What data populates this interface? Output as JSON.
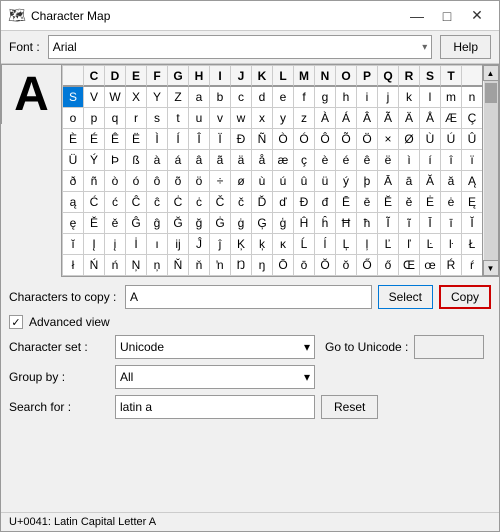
{
  "window": {
    "title": "Character Map",
    "icon": "🗺"
  },
  "titleButtons": {
    "minimize": "—",
    "maximize": "□",
    "close": "✕"
  },
  "toolbar": {
    "fontLabel": "Font :",
    "fontValue": "Arial",
    "helpLabel": "Help"
  },
  "grid": {
    "largeChar": "A",
    "headers": [
      "C",
      "D",
      "E",
      "F",
      "G",
      "H",
      "I",
      "J",
      "K",
      "L",
      "M",
      "N",
      "O",
      "P",
      "Q",
      "R",
      "S",
      "T"
    ],
    "rows": [
      [
        "S",
        "V",
        "W",
        "X",
        "Y",
        "Z",
        "a",
        "b",
        "c",
        "d",
        "e",
        "f",
        "g",
        "h",
        "i",
        "j",
        "k",
        "l",
        "m",
        "n"
      ],
      [
        "o",
        "p",
        "q",
        "r",
        "s",
        "t",
        "u",
        "v",
        "w",
        "x",
        "y",
        "z",
        "À",
        "Á",
        "Â",
        "Ã",
        "Ä",
        "Å",
        "Æ",
        "Ç"
      ],
      [
        "È",
        "É",
        "Ê",
        "Ë",
        "Ì",
        "Í",
        "Î",
        "Ï",
        "Ð",
        "Ñ",
        "Ò",
        "Ó",
        "Ô",
        "Õ",
        "Ö",
        "×",
        "Ø",
        "Ù",
        "Ú",
        "Û"
      ],
      [
        "Ü",
        "Ý",
        "Þ",
        "ß",
        "à",
        "á",
        "â",
        "ã",
        "ä",
        "å",
        "æ",
        "ç",
        "è",
        "é",
        "ê",
        "ë",
        "ì",
        "í",
        "î",
        "ï"
      ],
      [
        "ð",
        "ñ",
        "ò",
        "ó",
        "ô",
        "õ",
        "ö",
        "÷",
        "ø",
        "ù",
        "ú",
        "û",
        "ü",
        "ý",
        "þ",
        "Ā",
        "ā",
        "Ă",
        "ă",
        "Ą"
      ],
      [
        "ą",
        "Ć",
        "ć",
        "Ĉ",
        "ĉ",
        "Ċ",
        "ċ",
        "Č",
        "č",
        "Ď",
        "ď",
        "Đ",
        "đ",
        "Ē",
        "ē",
        "Ĕ",
        "ĕ",
        "Ė",
        "ė",
        "Ę"
      ],
      [
        "ę",
        "Ě",
        "ě",
        "Ĝ",
        "ĝ",
        "Ğ",
        "ğ",
        "Ġ",
        "ġ",
        "Ģ",
        "ģ",
        "Ĥ",
        "ĥ",
        "Ħ",
        "ħ",
        "Ĩ",
        "ĩ",
        "Ī",
        "ī",
        "Ĭ"
      ],
      [
        "ĭ",
        "Į",
        "į",
        "İ",
        "ı",
        "ĳ",
        "Ĵ",
        "ĵ",
        "Ķ",
        "ķ",
        "ĸ",
        "Ĺ",
        "ĺ",
        "Ļ",
        "ļ",
        "Ľ",
        "ľ",
        "Ŀ",
        "ŀ",
        "Ł"
      ],
      [
        "ł",
        "Ń",
        "ń",
        "Ņ",
        "ņ",
        "Ň",
        "ň",
        "ŉ",
        "Ŋ",
        "ŋ",
        "Ō",
        "ō",
        "Ŏ",
        "ŏ",
        "Ő",
        "ő",
        "Œ",
        "œ",
        "Ŕ",
        "ŕ"
      ]
    ],
    "selectedCell": {
      "row": 0,
      "col": 0
    }
  },
  "copySection": {
    "label": "Characters to copy :",
    "value": "A",
    "selectLabel": "Select",
    "copyLabel": "Copy"
  },
  "advanced": {
    "checked": true,
    "label": "Advanced view"
  },
  "charsetSection": {
    "label": "Character set :",
    "value": "Unicode",
    "gotoLabel": "Go to Unicode :",
    "gotoValue": ""
  },
  "groupSection": {
    "label": "Group by :",
    "value": "All"
  },
  "searchSection": {
    "label": "Search for :",
    "value": "latin a",
    "resetLabel": "Reset"
  },
  "statusBar": {
    "text": "U+0041: Latin Capital Letter A"
  }
}
